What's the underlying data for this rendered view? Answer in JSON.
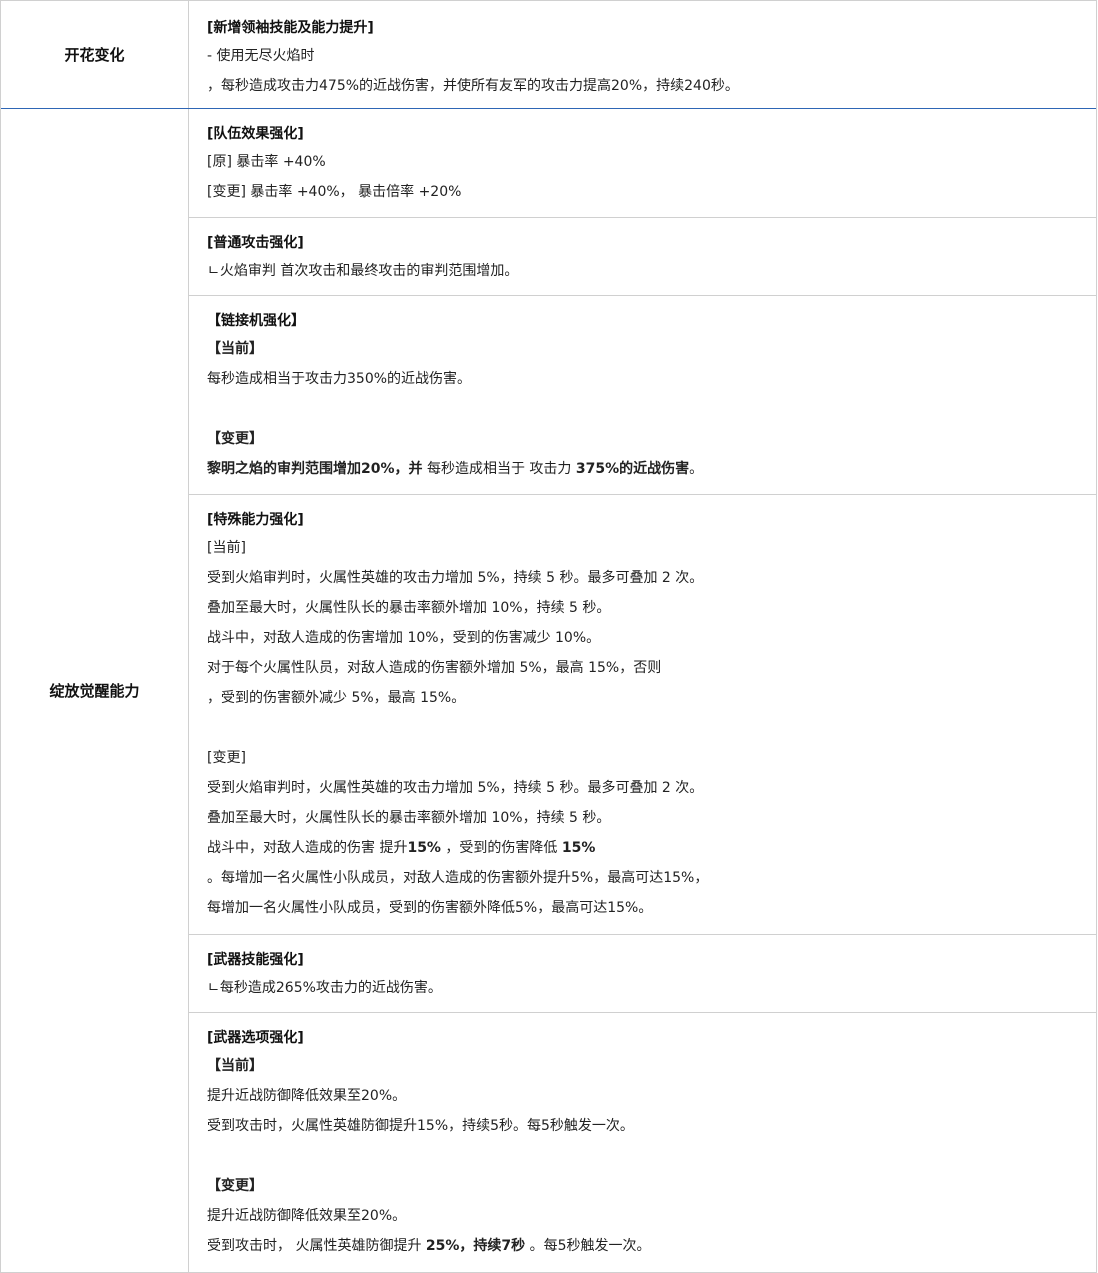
{
  "rows": [
    {
      "label": "开花变化",
      "blocks": [
        {
          "title": "[新增领袖技能及能力提升]",
          "lines": [
            "- 使用无尽火焰时",
            "，每秒造成攻击力475%的近战伤害，并使所有友军的攻击力提高20%，持续240秒。"
          ]
        }
      ]
    },
    {
      "label": "绽放觉醒能力",
      "blocks": [
        {
          "title": "[队伍效果强化]",
          "lines": [
            "[原] 暴击率 +40%",
            "[变更] 暴击率 +40%， 暴击倍率 +20%"
          ]
        },
        {
          "title": "[普通攻击强化]",
          "lines": [
            "ㄴ火焰审判 首次攻击和最终攻击的审判范围增加。"
          ]
        },
        {
          "title": "【链接机强化】",
          "current_label": "【当前】",
          "current": "每秒造成相当于攻击力350%的近战伤害。",
          "change_label": "【变更】",
          "change_bold_1": "黎明之焰的审判范围增加20%，并",
          "change_normal_1": " 每秒造成相当于 攻击力 ",
          "change_bold_2": "375%的近战伤害",
          "change_normal_2": "。"
        },
        {
          "title": "[特殊能力强化]",
          "current_label": "[当前]",
          "current_lines": [
            "受到火焰审判时，火属性英雄的攻击力增加 5%，持续 5 秒。最多可叠加 2 次。",
            "叠加至最大时，火属性队长的暴击率额外增加 10%，持续 5 秒。",
            "战斗中，对敌人造成的伤害增加 10%，受到的伤害减少 10%。",
            "对于每个火属性队员，对敌人造成的伤害额外增加 5%，最高 15%，否则",
            "，受到的伤害额外减少 5%，最高 15%。"
          ],
          "change_label": "[变更]",
          "change_lines_a": [
            "受到火焰审判时，火属性英雄的攻击力增加 5%，持续 5 秒。最多可叠加 2 次。",
            "叠加至最大时，火属性队长的暴击率额外增加 10%，持续 5 秒。"
          ],
          "change_mixed_1": "战斗中，对敌人造成的伤害 提升",
          "change_mixed_bold_1": "15%",
          "change_mixed_2": " ，受到的伤害降低 ",
          "change_mixed_bold_2": "15%",
          "change_lines_b": [
            "。每增加一名火属性小队成员，对敌人造成的伤害额外提升5%，最高可达15%，",
            "每增加一名火属性小队成员，受到的伤害额外降低5%，最高可达15%。"
          ]
        },
        {
          "title": "[武器技能强化]",
          "lines": [
            "ㄴ每秒造成265%攻击力的近战伤害。"
          ]
        },
        {
          "title": "[武器选项强化]",
          "current_label": "【当前】",
          "current_lines": [
            "提升近战防御降低效果至20%。",
            "受到攻击时，火属性英雄防御提升15%，持续5秒。每5秒触发一次。"
          ],
          "change_label": "【变更】",
          "change_line": "提升近战防御降低效果至20%。",
          "change_mixed_1": "受到攻击时， 火属性英雄防御提升 ",
          "change_mixed_bold": "25%，持续7秒",
          "change_mixed_2": " 。每5秒触发一次。"
        }
      ]
    }
  ]
}
